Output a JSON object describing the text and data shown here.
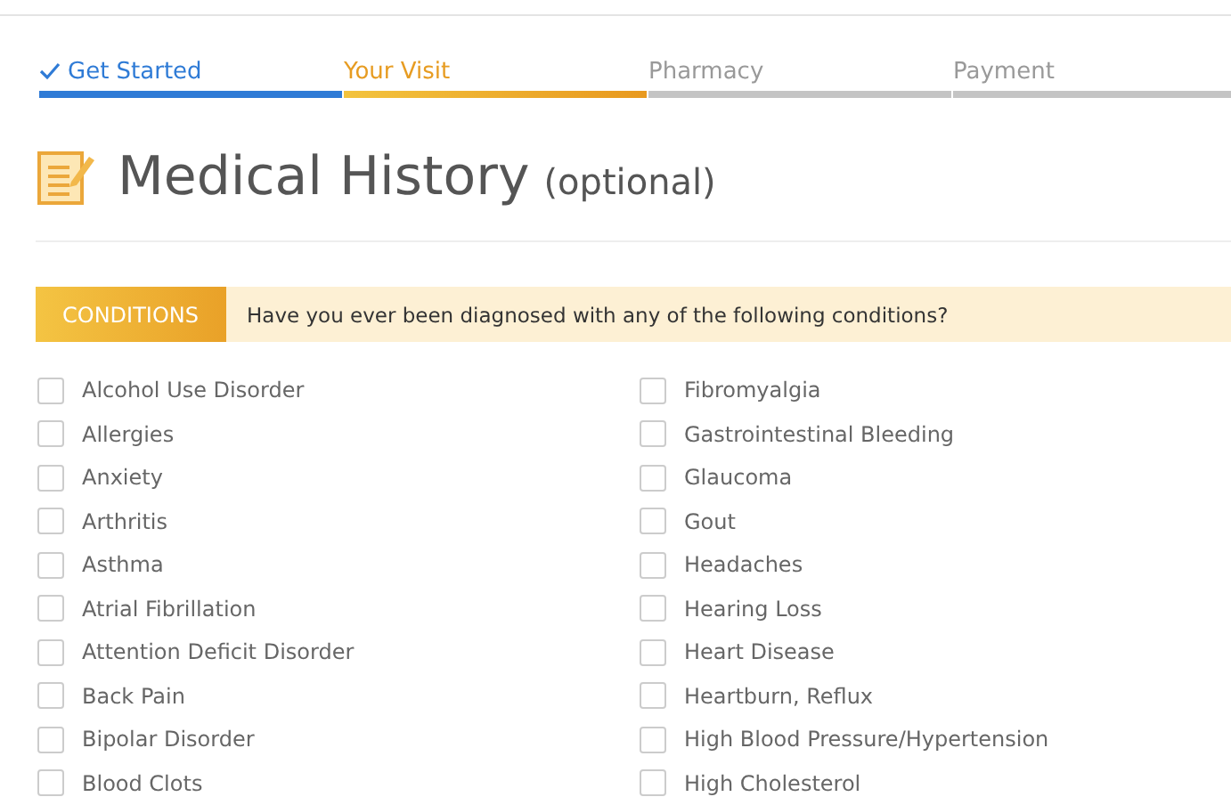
{
  "steps": [
    {
      "label": "Get Started",
      "completed": true,
      "selected": false
    },
    {
      "label": "Your Visit",
      "completed": false,
      "selected": true
    },
    {
      "label": "Pharmacy",
      "completed": false,
      "selected": false
    },
    {
      "label": "Payment",
      "completed": false,
      "selected": false
    }
  ],
  "heading": {
    "title": "Medical History",
    "note": "(optional)"
  },
  "section": {
    "tag": "CONDITIONS",
    "question": "Have you ever been diagnosed with any of the following conditions?"
  },
  "conditions": [
    {
      "label": "Alcohol Use Disorder",
      "checked": false
    },
    {
      "label": "Allergies",
      "checked": false
    },
    {
      "label": "Anxiety",
      "checked": false
    },
    {
      "label": "Arthritis",
      "checked": false
    },
    {
      "label": "Asthma",
      "checked": false
    },
    {
      "label": "Atrial Fibrillation",
      "checked": false
    },
    {
      "label": "Attention Deficit Disorder",
      "checked": false
    },
    {
      "label": "Back Pain",
      "checked": false
    },
    {
      "label": "Bipolar Disorder",
      "checked": false
    },
    {
      "label": "Blood Clots",
      "checked": false
    },
    {
      "label": "Fibromyalgia",
      "checked": false
    },
    {
      "label": "Gastrointestinal Bleeding",
      "checked": false
    },
    {
      "label": "Glaucoma",
      "checked": false
    },
    {
      "label": "Gout",
      "checked": false
    },
    {
      "label": "Headaches",
      "checked": false
    },
    {
      "label": "Hearing Loss",
      "checked": false
    },
    {
      "label": "Heart Disease",
      "checked": false
    },
    {
      "label": "Heartburn, Reflux",
      "checked": false
    },
    {
      "label": "High Blood Pressure/Hypertension",
      "checked": false
    },
    {
      "label": "High Cholesterol",
      "checked": false
    }
  ]
}
